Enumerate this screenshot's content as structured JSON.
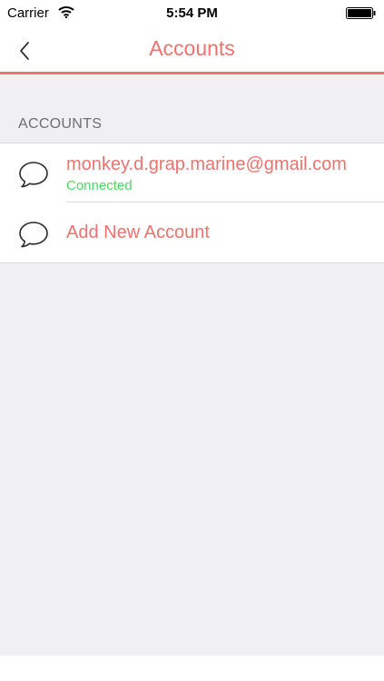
{
  "status_bar": {
    "carrier": "Carrier",
    "time": "5:54 PM",
    "wifi_icon": "wifi-icon",
    "battery_icon": "battery-icon"
  },
  "nav_bar": {
    "title": "Accounts",
    "back_icon": "chevron-left-icon"
  },
  "section": {
    "header": "ACCOUNTS"
  },
  "accounts": [
    {
      "title": "monkey.d.grap.marine@gmail.com",
      "status": "Connected",
      "icon": "chat-bubble-icon"
    }
  ],
  "add_account": {
    "label": "Add New Account",
    "icon": "chat-bubble-icon"
  },
  "colors": {
    "accent": "#f0716e",
    "connected": "#4cd964",
    "background": "#efeff4",
    "section_header": "#6d6d72"
  }
}
